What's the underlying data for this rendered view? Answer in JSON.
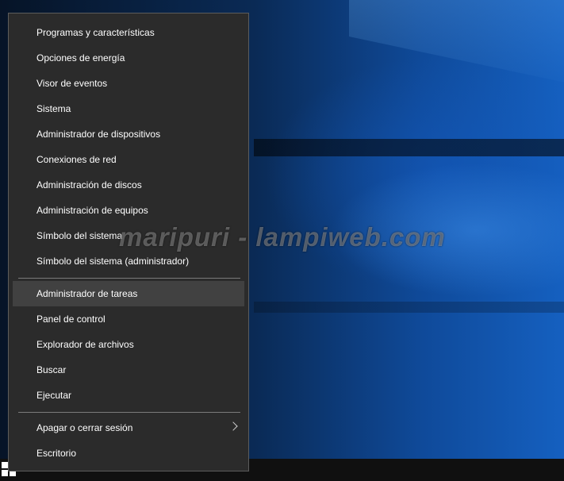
{
  "menu": {
    "group1": [
      {
        "label": "Programas y características"
      },
      {
        "label": "Opciones de energía"
      },
      {
        "label": "Visor de eventos"
      },
      {
        "label": "Sistema"
      },
      {
        "label": "Administrador de dispositivos"
      },
      {
        "label": "Conexiones de red"
      },
      {
        "label": "Administración de discos"
      },
      {
        "label": "Administración de equipos"
      },
      {
        "label": "Símbolo del sistema"
      },
      {
        "label": "Símbolo del sistema (administrador)"
      }
    ],
    "group2": [
      {
        "label": "Administrador de tareas"
      },
      {
        "label": "Panel de control"
      },
      {
        "label": "Explorador de archivos"
      },
      {
        "label": "Buscar"
      },
      {
        "label": "Ejecutar"
      }
    ],
    "group3": [
      {
        "label": "Apagar o cerrar sesión"
      },
      {
        "label": "Escritorio"
      }
    ]
  },
  "watermark": "maripuri - lampiweb.com",
  "taskbar": {
    "start_icon": "windows-logo-icon"
  }
}
